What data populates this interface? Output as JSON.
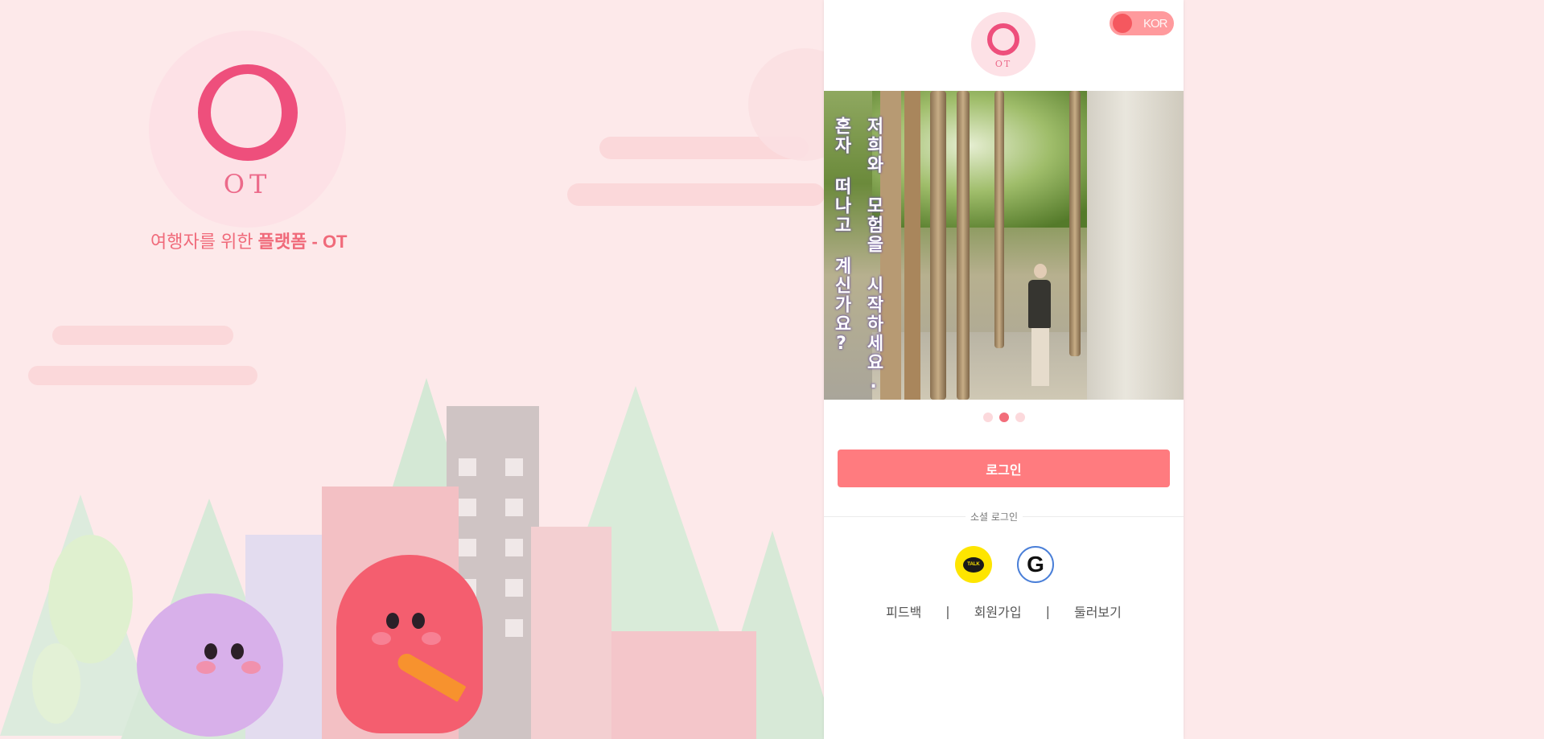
{
  "hero": {
    "logo_text": "OT",
    "tagline_plain": "여행자를 위한 ",
    "tagline_bold": "플랫폼 - OT"
  },
  "card": {
    "logo_text": "OT",
    "language_toggle": {
      "label": "KOR",
      "state": "on"
    },
    "banner": {
      "line_right": "저희와 모험을 시작하세요.",
      "line_left": "혼자 떠나고 계신가요?",
      "slides_count": 3,
      "active_slide": 2
    },
    "login_button": "로그인",
    "social_divider": "소셜 로그인",
    "social": [
      {
        "name": "kakao",
        "icon": "kakao-talk-icon",
        "label": "TALK"
      },
      {
        "name": "google",
        "icon": "google-icon",
        "label": "G"
      }
    ],
    "footer_links": [
      "피드백",
      "회원가입",
      "둘러보기"
    ],
    "footer_separator": "|"
  },
  "colors": {
    "accent": "#ff7b7f",
    "dot_active": "#f26d7a",
    "background": "#fde9ea"
  }
}
